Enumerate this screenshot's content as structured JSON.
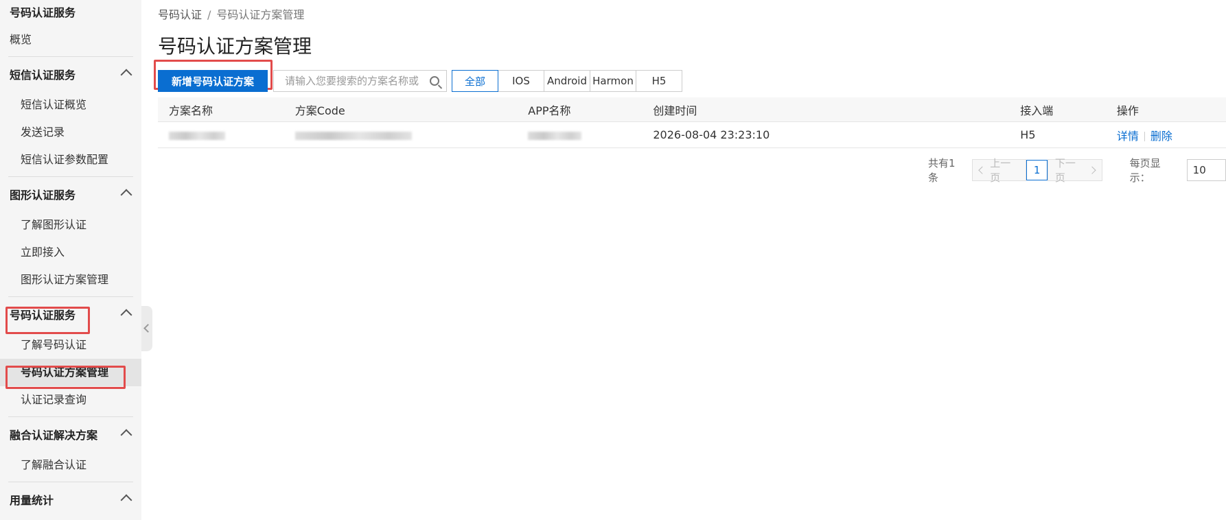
{
  "sidebar": {
    "title": "号码认证服务",
    "overview": "概览",
    "groups": [
      {
        "label": "短信认证服务",
        "items": [
          "短信认证概览",
          "发送记录",
          "短信认证参数配置"
        ]
      },
      {
        "label": "图形认证服务",
        "items": [
          "了解图形认证",
          "立即接入",
          "图形认证方案管理"
        ]
      },
      {
        "label": "号码认证服务",
        "items": [
          "了解号码认证",
          "号码认证方案管理",
          "认证记录查询"
        ]
      },
      {
        "label": "融合认证解决方案",
        "items": [
          "了解融合认证"
        ]
      },
      {
        "label": "用量统计",
        "items": []
      }
    ],
    "active_item": "号码认证方案管理"
  },
  "breadcrumb": {
    "parent": "号码认证",
    "separator": "/",
    "current": "号码认证方案管理"
  },
  "page_title": "号码认证方案管理",
  "toolbar": {
    "add_button": "新增号码认证方案",
    "search_placeholder": "请输入您要搜索的方案名称或",
    "filters": [
      "全部",
      "IOS",
      "Android",
      "Harmon",
      "H5"
    ],
    "active_filter": "全部"
  },
  "table": {
    "columns": [
      "方案名称",
      "方案Code",
      "APP名称",
      "创建时间",
      "接入端",
      "操作"
    ],
    "rows": [
      {
        "name": "",
        "code": "",
        "app": "",
        "created": "2026-08-04 23:23:10",
        "platform": "H5",
        "actions": [
          "详情",
          "删除"
        ]
      }
    ]
  },
  "pagination": {
    "total": "共有1条",
    "prev": "上一页",
    "page": "1",
    "next": "下一页",
    "per_page_label": "每页显示：",
    "page_size": "10"
  },
  "colors": {
    "primary": "#0a6ed1",
    "highlight": "#e24b4b",
    "sidebar_bg": "#f5f5f5"
  }
}
